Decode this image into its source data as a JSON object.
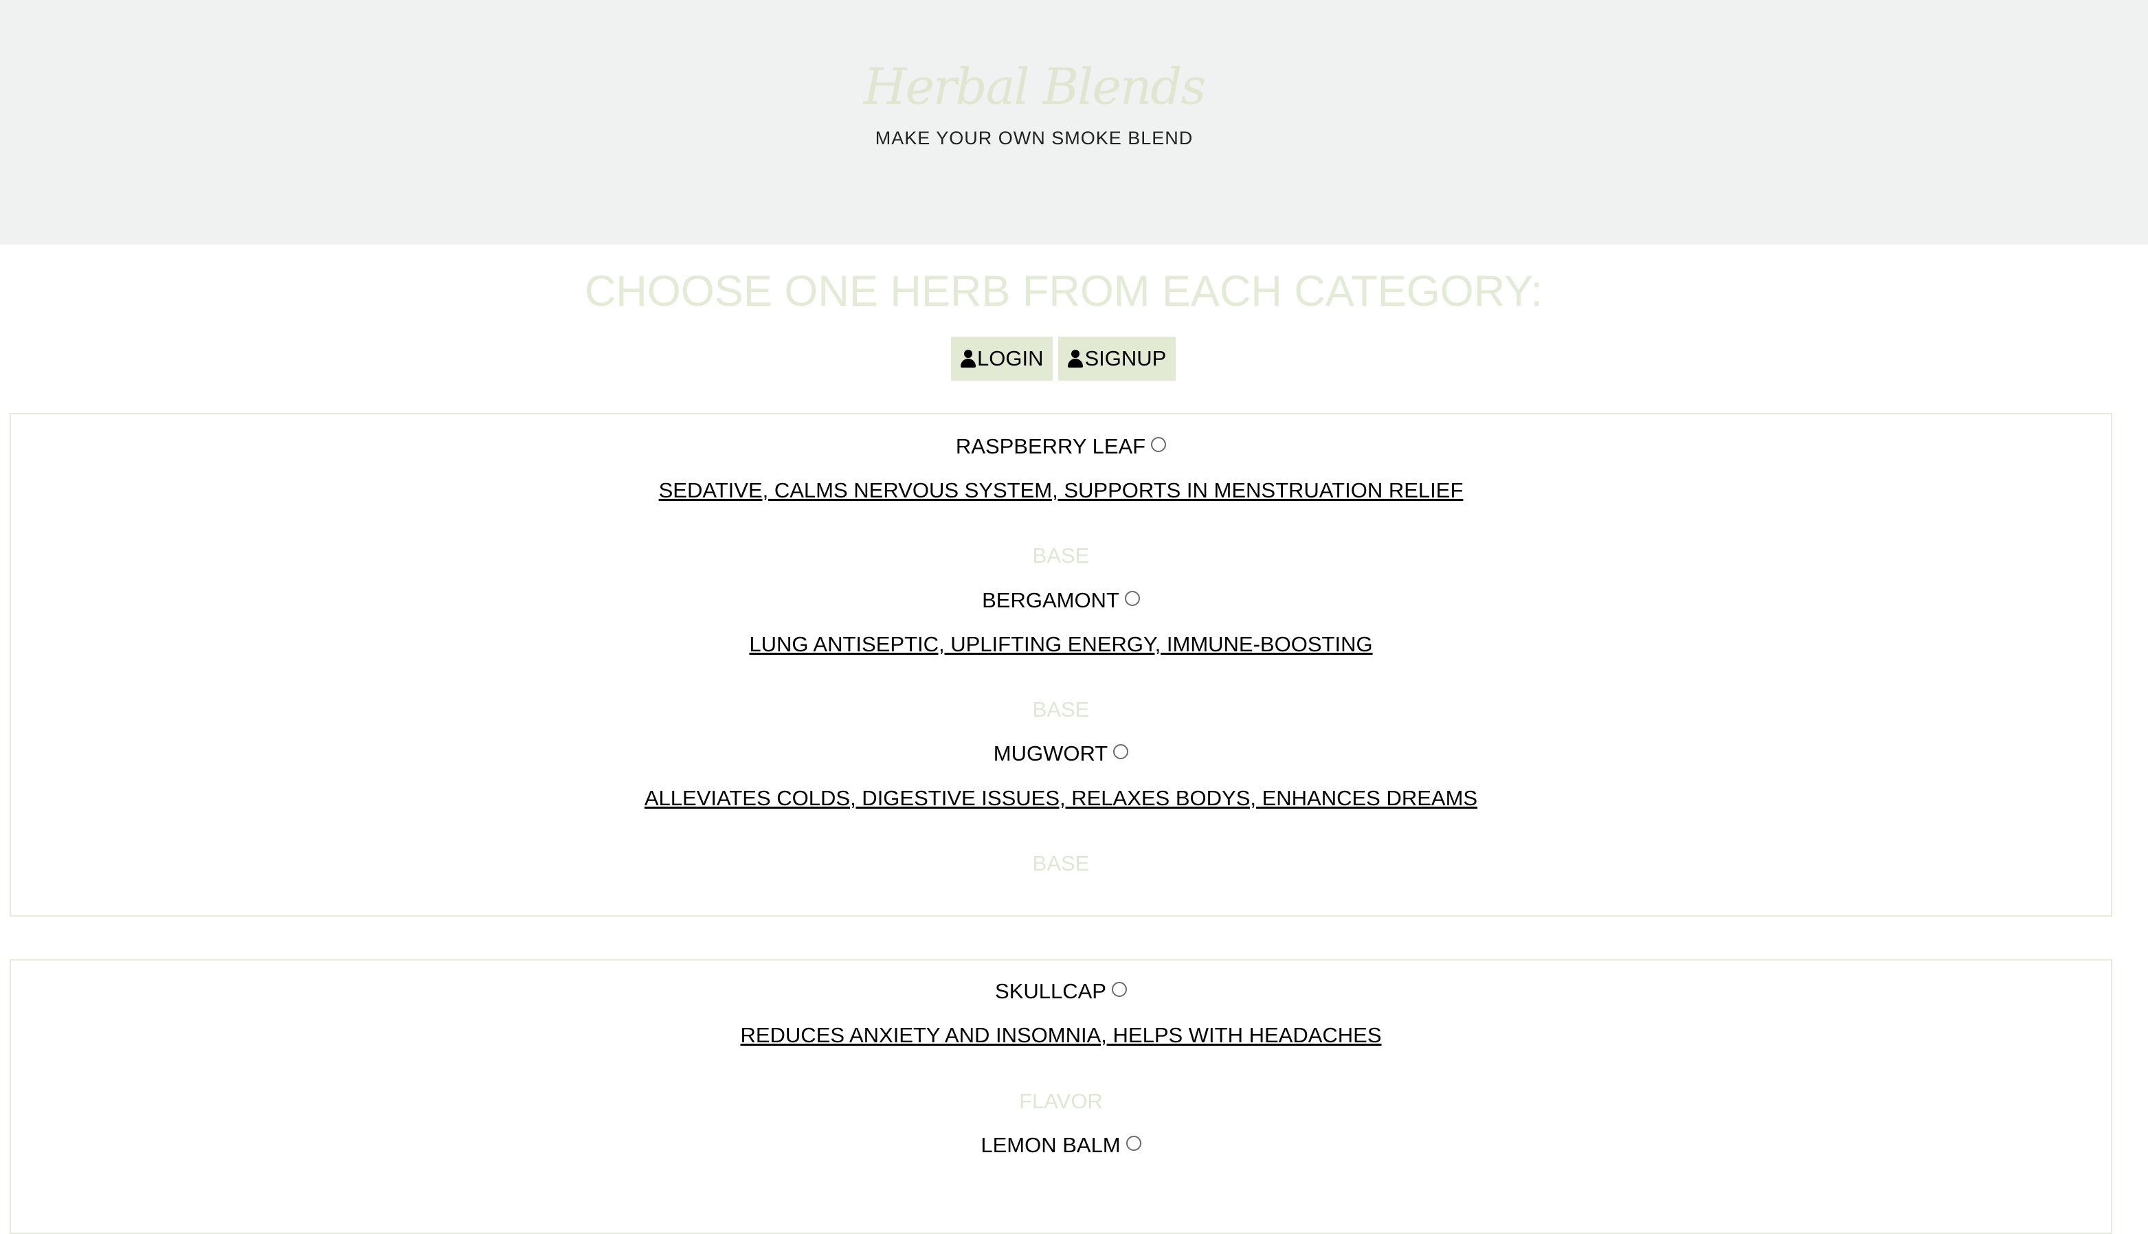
{
  "header": {
    "logo": "Herbal Blends",
    "tagline": "MAKE YOUR OWN SMOKE BLEND"
  },
  "main": {
    "heading": "CHOOSE ONE HERB FROM EACH CATEGORY:",
    "login_label": "LOGIN",
    "signup_label": "SIGNUP"
  },
  "groups": [
    {
      "herbs": [
        {
          "name": "RASPBERRY LEAF",
          "description": "SEDATIVE, CALMS NERVOUS SYSTEM, SUPPORTS IN MENSTRUATION RELIEF",
          "category": "BASE"
        },
        {
          "name": "BERGAMONT",
          "description": "LUNG ANTISEPTIC, UPLIFTING ENERGY, IMMUNE-BOOSTING",
          "category": "BASE"
        },
        {
          "name": "MUGWORT",
          "description": "ALLEVIATES COLDS, DIGESTIVE ISSUES, RELAXES BODYS, ENHANCES DREAMS",
          "category": "BASE"
        }
      ]
    },
    {
      "herbs": [
        {
          "name": "SKULLCAP",
          "description": "REDUCES ANXIETY AND INSOMNIA, HELPS WITH HEADACHES",
          "category": "FLAVOR"
        },
        {
          "name": "LEMON BALM"
        }
      ]
    }
  ],
  "colors": {
    "header_bg": "#f0f2f1",
    "accent": "#e3ead4",
    "card_border": "#e5eadb"
  }
}
